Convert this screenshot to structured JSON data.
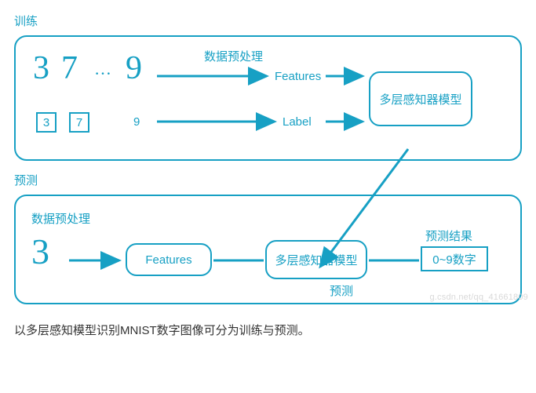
{
  "train": {
    "title": "训练",
    "digits_top": [
      "3",
      "7",
      "…",
      "9"
    ],
    "boxed_digits": [
      "3",
      "7"
    ],
    "loose_digit": "9",
    "preprocess_label": "数据预处理",
    "features_label": "Features",
    "label_label": "Label",
    "model_label": "多层感知器模型"
  },
  "predict": {
    "title": "预测",
    "preprocess_label": "数据预处理",
    "input_digit": "3",
    "features_label": "Features",
    "model_label": "多层感知器模型",
    "predict_word": "预测",
    "result_title": "预测结果",
    "result_box": "0~9数字"
  },
  "caption": "以多层感知模型识别MNIST数字图像可分为训练与预测。",
  "watermark": "g.csdn.net/qq_41661809",
  "colors": {
    "accent": "#17a0c4"
  }
}
